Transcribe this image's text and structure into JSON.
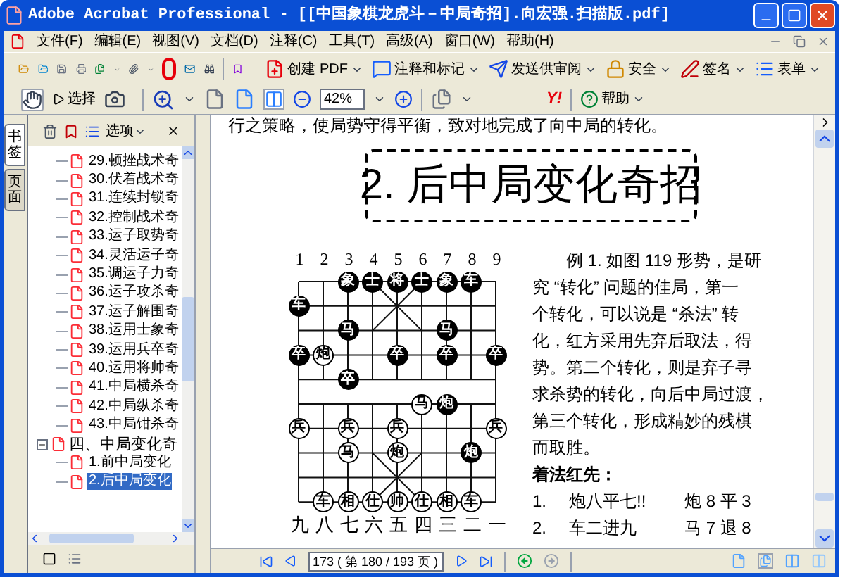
{
  "window": {
    "title": "Adobe Acrobat Professional - [[中国象棋龙虎斗－中局奇招].向宏强.扫描版.pdf]"
  },
  "menu": [
    "文件(F)",
    "编辑(E)",
    "视图(V)",
    "文档(D)",
    "注释(C)",
    "工具(T)",
    "高级(A)",
    "窗口(W)",
    "帮助(H)"
  ],
  "toolbar": {
    "tasks": [
      "创建 PDF",
      "注释和标记",
      "发送供审阅",
      "安全",
      "签名",
      "表单"
    ],
    "select_label": "选择",
    "zoom": "42%",
    "search_logo": "Y!",
    "help": "帮助"
  },
  "navigation": {
    "tabs": [
      {
        "label": "书签",
        "selected": true
      },
      {
        "label": "页面",
        "selected": false
      }
    ],
    "options": "选项",
    "continued_items": [
      {
        "label": "29.顿挫战术奇",
        "selected": false
      },
      {
        "label": "30.伏着战术奇",
        "selected": false
      },
      {
        "label": "31.连续封锁奇",
        "selected": false
      },
      {
        "label": "32.控制战术奇",
        "selected": false
      },
      {
        "label": "33.运子取势奇",
        "selected": false
      },
      {
        "label": "34.灵活运子奇",
        "selected": false
      },
      {
        "label": "35.调运子力奇",
        "selected": false
      },
      {
        "label": "36.运子攻杀奇",
        "selected": false
      },
      {
        "label": "37.运子解围奇",
        "selected": false
      },
      {
        "label": "38.运用士象奇",
        "selected": false
      },
      {
        "label": "39.运用兵卒奇",
        "selected": false
      },
      {
        "label": "40.运用将帅奇",
        "selected": false
      },
      {
        "label": "41.中局横杀奇",
        "selected": false
      },
      {
        "label": "42.中局纵杀奇",
        "selected": false
      },
      {
        "label": "43.中局钳杀奇",
        "selected": false
      }
    ],
    "items": [
      {
        "label": "四、中局变化奇",
        "selected": false,
        "expanded": true,
        "children": [
          {
            "label": "1.前中局变化",
            "selected": false
          },
          {
            "label": "2.后中局变化",
            "selected": true
          }
        ]
      }
    ]
  },
  "document": {
    "top_line": "行之策略，使局势守得平衡，致对地完成了向中局的转化。",
    "heading": "2. 后中局变化奇招",
    "board": {
      "file_numbers": [
        "1",
        "2",
        "3",
        "4",
        "5",
        "6",
        "7",
        "8",
        "9"
      ],
      "rank_numbers": [
        "九",
        "八",
        "七",
        "六",
        "五",
        "四",
        "三",
        "二",
        "一"
      ],
      "rows": [
        [
          null,
          null,
          {
            "piece": "象",
            "filled": true
          },
          {
            "piece": "士",
            "filled": true
          },
          {
            "piece": "将",
            "filled": true
          },
          {
            "piece": "士",
            "filled": true
          },
          {
            "piece": "象",
            "filled": true
          },
          {
            "piece": "车",
            "filled": true
          },
          null
        ],
        [
          {
            "piece": "车",
            "filled": true
          },
          null,
          null,
          null,
          null,
          null,
          null,
          null,
          null
        ],
        [
          null,
          null,
          {
            "piece": "马",
            "filled": true
          },
          null,
          null,
          null,
          {
            "piece": "马",
            "filled": true
          },
          null,
          null
        ],
        [
          {
            "piece": "卒",
            "filled": true
          },
          {
            "piece": "炮",
            "filled": false
          },
          null,
          null,
          {
            "piece": "卒",
            "filled": true
          },
          null,
          {
            "piece": "卒",
            "filled": true
          },
          null,
          {
            "piece": "卒",
            "filled": true
          }
        ],
        [
          null,
          null,
          {
            "piece": "卒",
            "filled": true
          },
          null,
          null,
          null,
          null,
          null,
          null
        ],
        [
          null,
          null,
          null,
          null,
          null,
          {
            "piece": "马",
            "filled": false
          },
          {
            "piece": "炮",
            "filled": true
          },
          null,
          null
        ],
        [
          {
            "piece": "兵",
            "filled": false
          },
          null,
          {
            "piece": "兵",
            "filled": false
          },
          null,
          {
            "piece": "兵",
            "filled": false
          },
          null,
          null,
          null,
          {
            "piece": "兵",
            "filled": false
          }
        ],
        [
          null,
          null,
          {
            "piece": "马",
            "filled": false
          },
          null,
          {
            "piece": "炮",
            "filled": false
          },
          null,
          null,
          {
            "piece": "炮",
            "filled": true
          },
          null
        ],
        [
          null,
          null,
          null,
          null,
          null,
          null,
          null,
          null,
          null
        ],
        [
          null,
          {
            "piece": "车",
            "filled": false
          },
          {
            "piece": "相",
            "filled": false
          },
          {
            "piece": "仕",
            "filled": false
          },
          {
            "piece": "帅",
            "filled": false
          },
          {
            "piece": "仕",
            "filled": false
          },
          {
            "piece": "相",
            "filled": false
          },
          {
            "piece": "车",
            "filled": false
          },
          null
        ]
      ]
    },
    "text_lines": [
      "例 1. 如图 119 形势，是研",
      "究 “转化” 问题的佳局，第一",
      "个转化，可以说是 “杀法” 转",
      "化，红方采用先弃后取法，得",
      "势。第二个转化，则是弃子寻",
      "求杀势的转化，向后中局过渡，",
      "第三个转化，形成精妙的残棋",
      "而取胜。"
    ],
    "moves_heading": "着法红先：",
    "moves": [
      {
        "number": "1.",
        "red": "炮八平七!!",
        "black": "炮 8 平 3"
      },
      {
        "number": "2.",
        "red": "车二进九",
        "black": "马 7 退 8"
      }
    ]
  },
  "status_bar": {
    "page": "173 ( 第 180 / 193 页 )"
  }
}
